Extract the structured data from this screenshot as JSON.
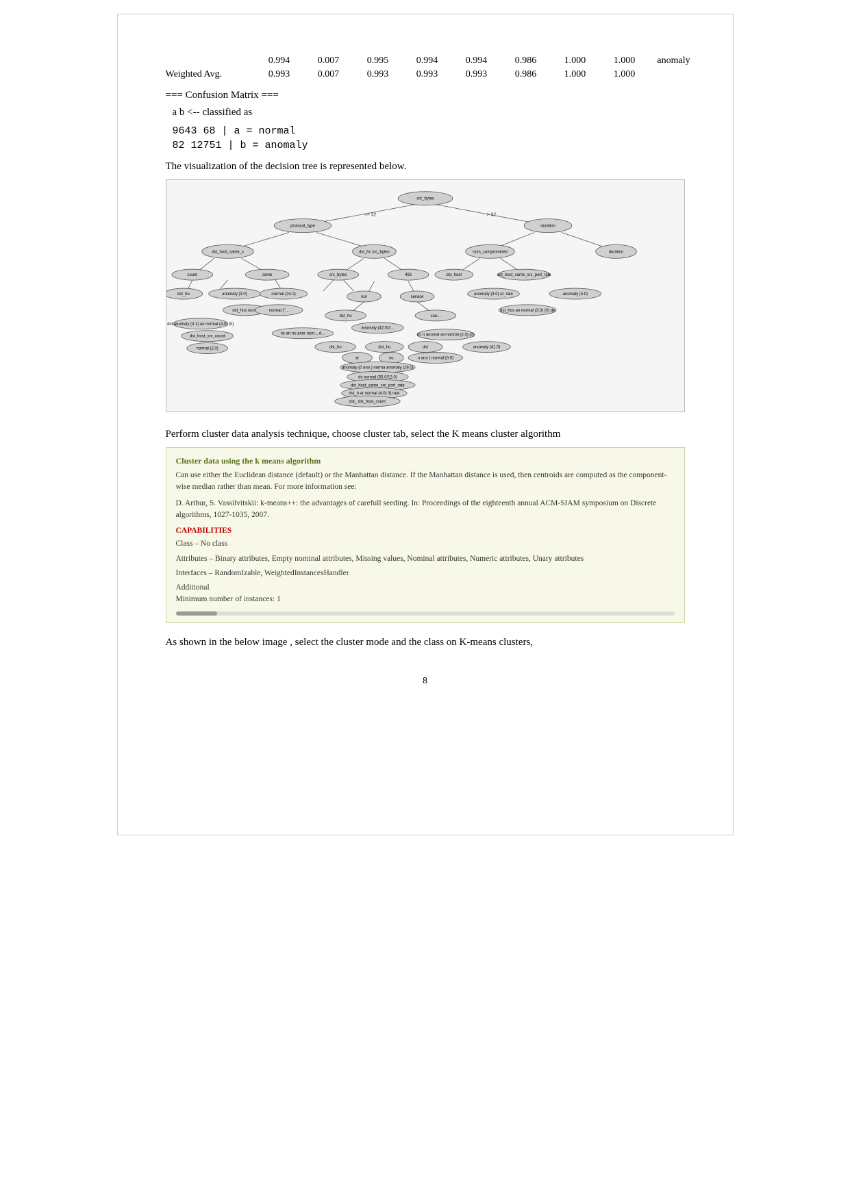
{
  "stats": {
    "row1": {
      "label": "",
      "values": [
        "0.994",
        "0.007",
        "0.995",
        "0.994",
        "0.994",
        "0.986",
        "1.000",
        "1.000"
      ],
      "suffix": "anomaly"
    },
    "row2": {
      "label": "Weighted Avg.",
      "values": [
        "0.993",
        "0.007",
        "0.993",
        "0.993",
        "0.993",
        "0.986",
        "1.000",
        "1.000"
      ]
    }
  },
  "confusion_matrix": {
    "title": "=== Confusion Matrix ===",
    "classified_as": "a    b   <-- classified as",
    "row1": " 9643   68 |    a = normal",
    "row2": "   82 12751 |    b = anomaly"
  },
  "tree_caption": "The visualization of the decision tree is represented below.",
  "cluster_caption": "Perform cluster data analysis technique, choose cluster tab, select the K means cluster algorithm",
  "cluster_box": {
    "title": "Cluster data using the k means algorithm",
    "body1": "Can use either the Euclidean distance (default) or the Manhattan distance. If the Manhattan distance is used, then centroids are computed as the component-wise median rather than mean. For more information see:",
    "body2": "D. Arthur, S. Vassilvitskii: k-means++: the advantages of carefull seeding. In: Proceedings of the eighteenth annual ACM-SIAM symposium on Discrete algorithms, 1027-1035, 2007.",
    "cap_title": "CAPABILITIES",
    "cap_body1": "Class – No class",
    "cap_body2": "Attributes – Binary attributes, Empty nominal attributes, Missing values, Nominal attributes, Numeric attributes, Unary attributes",
    "cap_body3": "Interfaces – RandomIzable, WeightedInstancesHandler",
    "cap_body4": "Additional\nMinimum number of instances: 1"
  },
  "final_caption": "As shown in the below image , select the cluster mode and the class on K-means clusters,",
  "page_number": "8",
  "colors": {
    "node_fill": "#d0d0d0",
    "node_stroke": "#555",
    "box_border": "#c8d8a0",
    "box_bg": "#f8f8e8",
    "cap_title_color": "#c00000",
    "box_title_color": "#5a7020"
  }
}
